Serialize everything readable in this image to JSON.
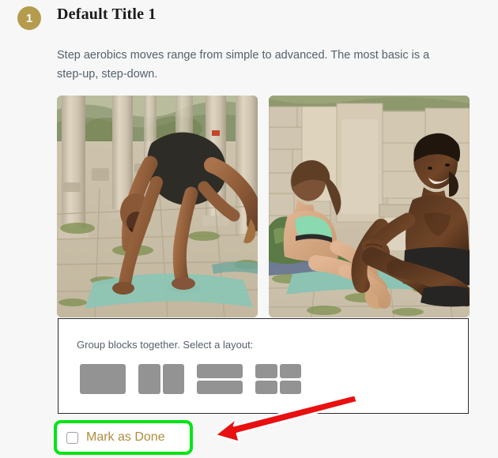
{
  "page": {
    "background_color": "#f7f7f7"
  },
  "header": {
    "step_number": "1",
    "badge_color": "#b49b4e",
    "title": "Default Title 1"
  },
  "content": {
    "paragraph": "Step aerobics moves range from simple to advanced. The most basic is a step-up, step-down.",
    "images": [
      {
        "alt": "Man in black shorts performing an advanced yoga arm-balance pose on a teal mat among ancient stone ruins and columns",
        "name": "photo-yoga-arm-balance"
      },
      {
        "alt": "A woman in a green sports bra and leggings and a man in black shorts sitting on yoga mats stretching in ancient stone ruins",
        "name": "photo-couple-stretching"
      }
    ]
  },
  "layout_panel": {
    "label": "Group blocks together. Select a layout:",
    "options": [
      {
        "name": "layout-single",
        "cells": 1,
        "class": "lay-1"
      },
      {
        "name": "layout-two-columns",
        "cells": 2,
        "class": "lay-2"
      },
      {
        "name": "layout-two-rows",
        "cells": 2,
        "class": "lay-3"
      },
      {
        "name": "layout-grid-2x2",
        "cells": 4,
        "class": "lay-4"
      }
    ]
  },
  "mark_as_done": {
    "label": "Mark as Done",
    "checked": false,
    "label_color": "#b08d3f",
    "highlight_color": "#00e515"
  },
  "annotation": {
    "arrow_color": "#e81010",
    "arrow_outline_color": "#ffffff",
    "points_to": "mark-as-done-checkbox"
  }
}
